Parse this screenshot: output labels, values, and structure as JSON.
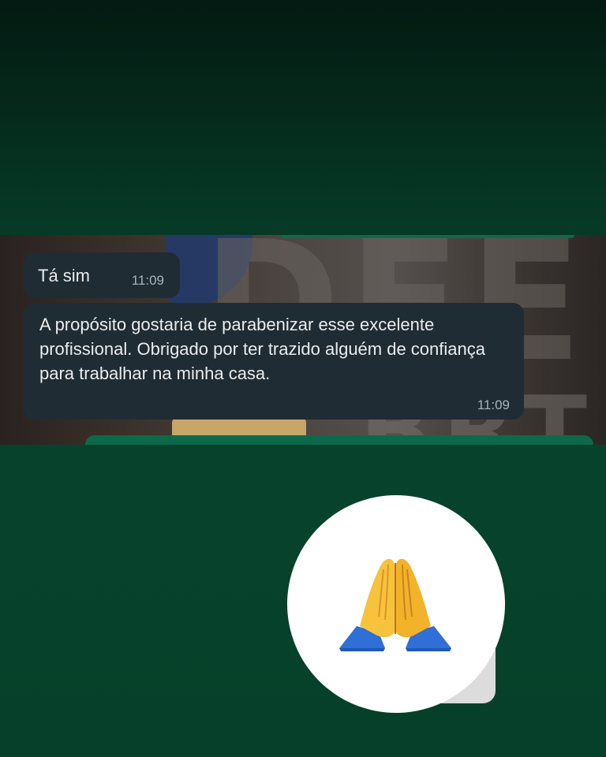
{
  "messages": [
    {
      "text": "Tá sim",
      "time": "11:09"
    },
    {
      "text": "A propósito gostaria de parabenizar esse excelente profissional. Obrigado por ter trazido alguém de confiança para trabalhar na minha casa.",
      "time": "11:09"
    }
  ],
  "reaction": {
    "icon": "folded-hands-icon"
  },
  "colors": {
    "bubble": "#202c33",
    "text": "#e9edef",
    "timestamp": "#a8b3b9",
    "background": "#06402a"
  }
}
